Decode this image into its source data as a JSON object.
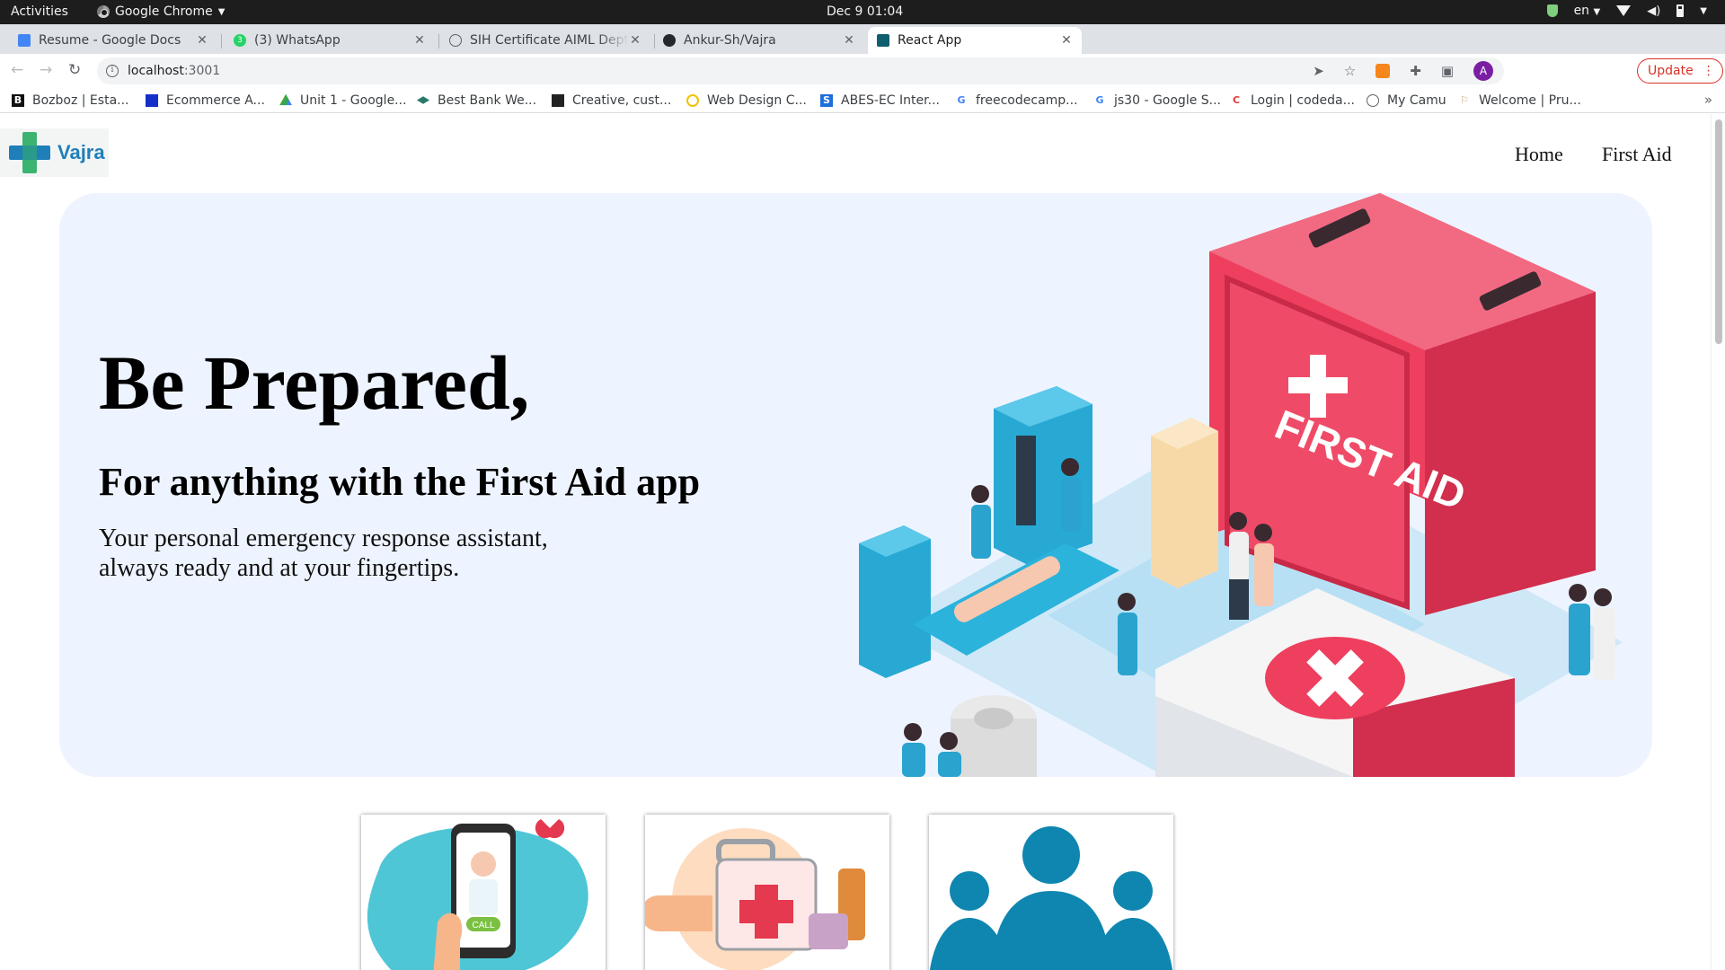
{
  "os_bar": {
    "activities": "Activities",
    "app_name": "Google Chrome",
    "clock": "Dec 9  01:04",
    "lang": "en"
  },
  "tabs": [
    {
      "title": "Resume - Google Docs",
      "favicon": "google-docs-icon",
      "color": "#4285f4"
    },
    {
      "title": "(3) WhatsApp",
      "favicon": "whatsapp-icon",
      "color": "#25d366",
      "badge": "3"
    },
    {
      "title": "SIH Certificate AIML Dept",
      "favicon": "globe-icon",
      "color": "#5f6368"
    },
    {
      "title": "Ankur-Sh/Vajra",
      "favicon": "github-icon",
      "color": "#24292f"
    },
    {
      "title": "React App",
      "favicon": "react-icon",
      "color": "#0f5e6e",
      "active": true
    }
  ],
  "omnibox": {
    "host": "localhost",
    "port": ":3001"
  },
  "update_label": "Update",
  "bookmarks": [
    {
      "label": "Bozboz | Esta...",
      "icon": "B"
    },
    {
      "label": "Ecommerce A...",
      "icon": ""
    },
    {
      "label": "Unit 1 - Google...",
      "icon": ""
    },
    {
      "label": "Best Bank We...",
      "icon": ""
    },
    {
      "label": "Creative, cust...",
      "icon": ""
    },
    {
      "label": "Web Design C...",
      "icon": ""
    },
    {
      "label": "ABES-EC Inter...",
      "icon": "S"
    },
    {
      "label": "freecodecamp...",
      "icon": "G"
    },
    {
      "label": "js30 - Google S...",
      "icon": "G"
    },
    {
      "label": "Login | codeda...",
      "icon": "C"
    },
    {
      "label": "My Camu",
      "icon": ""
    },
    {
      "label": "Welcome | Pru...",
      "icon": ""
    }
  ],
  "site": {
    "brand": "Vajra",
    "nav": {
      "home": "Home",
      "first_aid": "First Aid"
    },
    "hero": {
      "title": "Be Prepared,",
      "subtitle": "For anything with the First Aid app",
      "description": "Your personal emergency response assistant, always ready and at your fingertips.",
      "illustration_label": "FIRST AID"
    },
    "cards": [
      {
        "name": "doctor-call-card",
        "call_label": "CALL"
      },
      {
        "name": "first-aid-kit-card"
      },
      {
        "name": "community-card"
      }
    ]
  },
  "colors": {
    "hero_bg": "#eef4ff",
    "kit_red": "#ee3f5e",
    "brand_blue": "#1f7fb8",
    "brand_green": "#3cb371",
    "update_red": "#d93025"
  }
}
